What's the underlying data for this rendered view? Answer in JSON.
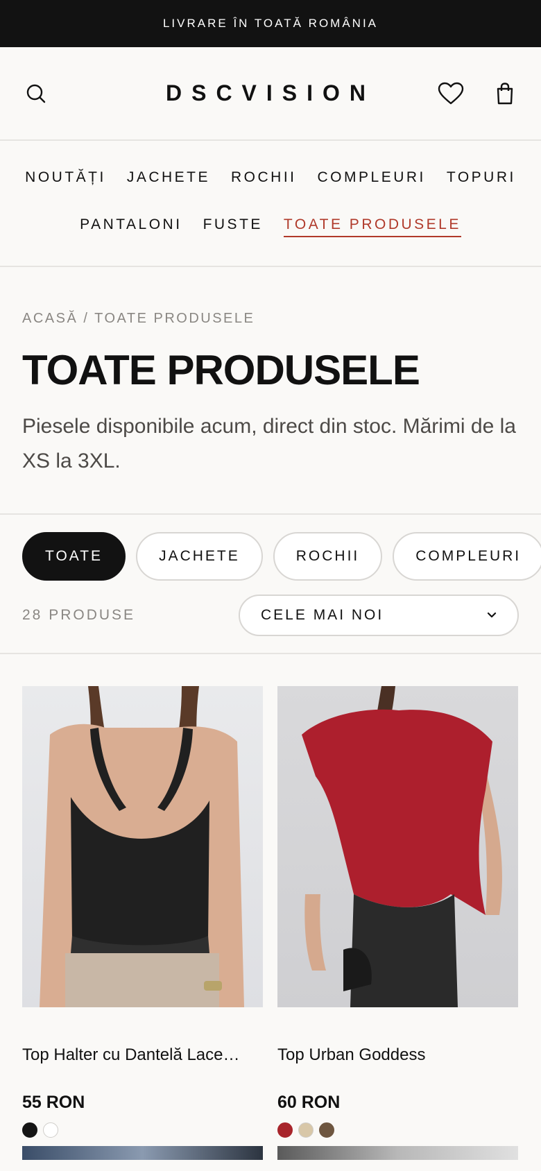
{
  "announcement": "LIVRARE ÎN TOATĂ ROMÂNIA",
  "brand": "DSCVISION",
  "icons": {
    "search": "search-icon",
    "wishlist": "heart-icon",
    "bag": "shopping-bag-icon",
    "sort": "chevron-down-icon"
  },
  "nav": {
    "row1": [
      "NOUTĂȚI",
      "JACHETE",
      "ROCHII",
      "COMPLEURI",
      "TOPURI"
    ],
    "row2": [
      "PANTALONI",
      "FUSTE",
      "TOATE PRODUSELE"
    ],
    "active": "TOATE PRODUSELE"
  },
  "breadcrumb": "ACASĂ / TOATE PRODUSELE",
  "page_title": "TOATE PRODUSELE",
  "description": "Piesele disponibile acum, direct din stoc. Mărimi de la XS la 3XL.",
  "filters": [
    "TOATE",
    "JACHETE",
    "ROCHII",
    "COMPLEURI"
  ],
  "active_filter": "TOATE",
  "product_count": "28 PRODUSE",
  "sort_label": "CELE MAI NOI",
  "colors": {
    "accent": "#b0392a",
    "dark": "#121212"
  },
  "products": [
    {
      "name": "Top Halter cu Dantelă Lace…",
      "price": "55 RON",
      "swatches": [
        "#151515",
        "#ffffff"
      ]
    },
    {
      "name": "Top Urban Goddess",
      "price": "60 RON",
      "swatches": [
        "#a8252b",
        "#d8c7a8",
        "#6e5640"
      ]
    }
  ]
}
